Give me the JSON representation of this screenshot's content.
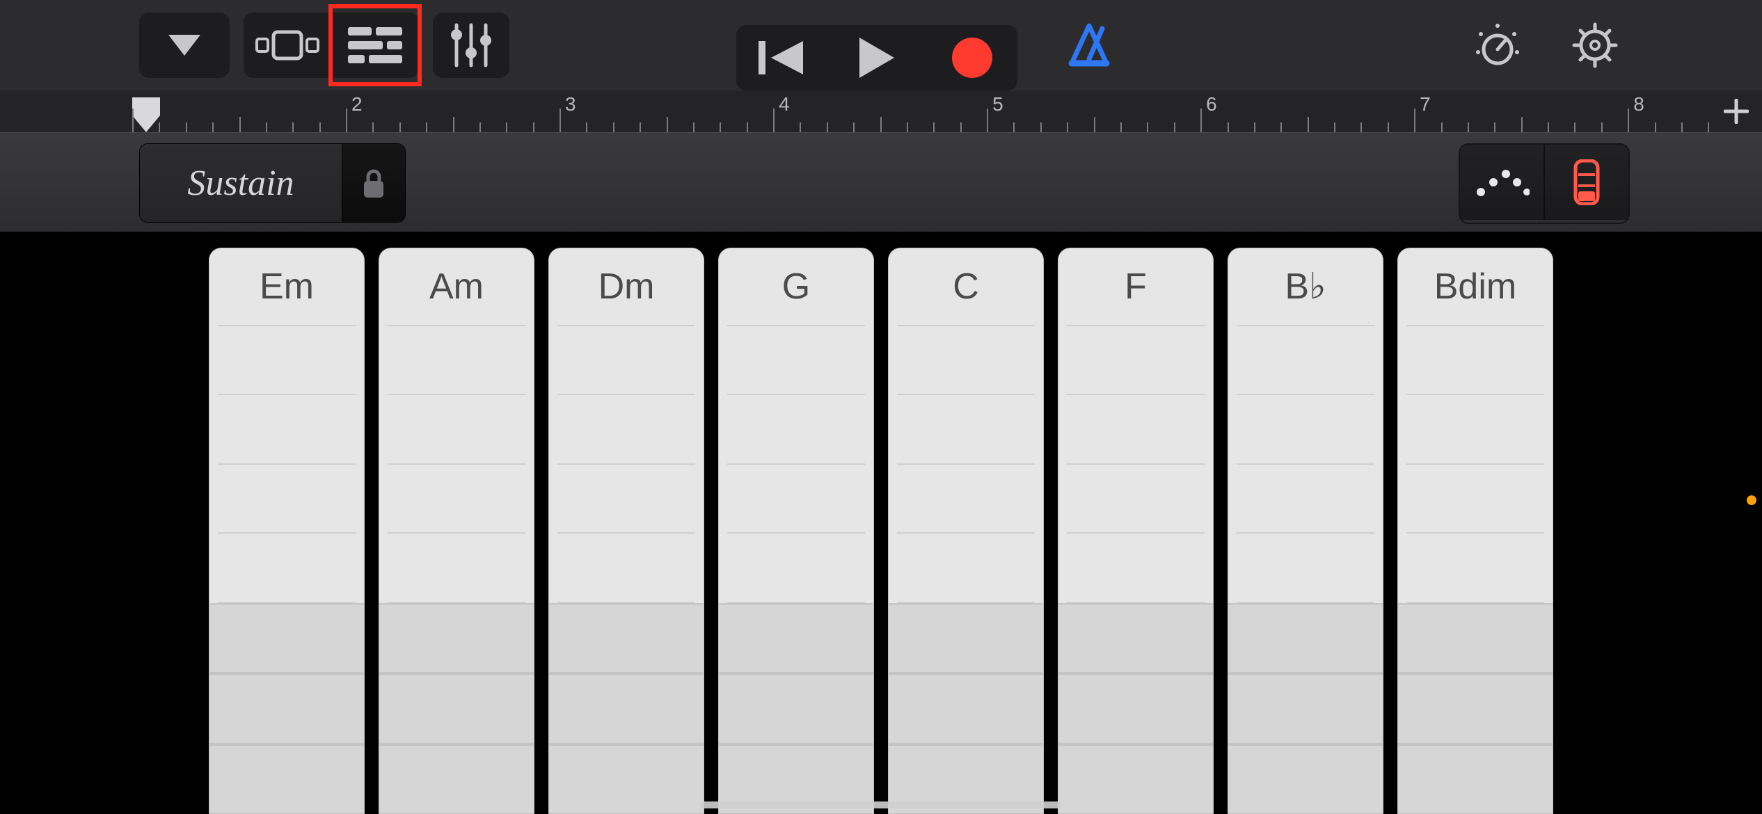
{
  "ruler": {
    "bars": [
      "2",
      "3",
      "4",
      "5",
      "6",
      "7",
      "8"
    ]
  },
  "secondary": {
    "sustain_label": "Sustain"
  },
  "chords": [
    {
      "label": "Em"
    },
    {
      "label": "Am"
    },
    {
      "label": "Dm"
    },
    {
      "label": "G"
    },
    {
      "label": "C"
    },
    {
      "label": "F"
    },
    {
      "label": "B♭"
    },
    {
      "label": "Bdim"
    }
  ],
  "colors": {
    "record": "#ff3b30",
    "metronome": "#2d76f6",
    "highlight_red": "#ff2a1f",
    "chord_view_active": "#ff5a4a"
  }
}
